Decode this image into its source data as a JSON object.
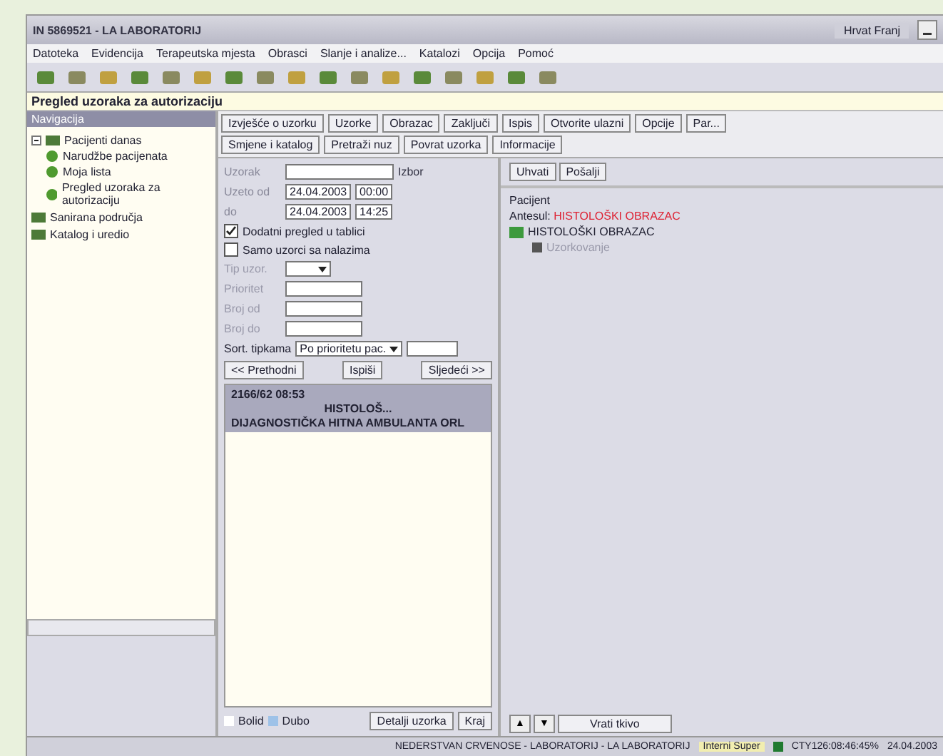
{
  "window": {
    "title": "IN 5869521 - LA LABORATORIJ",
    "user": "Hrvat Franj"
  },
  "menu": [
    "Datoteka",
    "Evidencija",
    "Terapeutska mjesta",
    "Obrasci",
    "Slanje i analize...",
    "Katalozi",
    "Opcija",
    "Pomoć"
  ],
  "header": "Pregled uzoraka za autorizaciju",
  "sidebar": {
    "title": "Navigacija",
    "items": [
      {
        "label": "Pacijenti danas",
        "expanded": true,
        "children": [
          {
            "label": "Narudžbe pacijenata"
          },
          {
            "label": "Moja lista"
          },
          {
            "label": "Pregled uzoraka za autorizaciju"
          }
        ]
      },
      {
        "label": "Sanirana područja"
      },
      {
        "label": "Katalog i uredio"
      }
    ]
  },
  "actions_row1": [
    "Izvješće o uzorku",
    "Uzorke",
    "Obrazac",
    "Zaključi",
    "Ispis",
    "Otvorite ulazni",
    "Opcije",
    "Par..."
  ],
  "actions_row2": [
    "Smjene i katalog",
    "Pretraži nuz",
    "Povrat uzorka",
    "Informacije"
  ],
  "filter": {
    "sample_label": "Uzorak",
    "find": "Izbor",
    "from_label": "Uzeto od",
    "to_label": "do",
    "from_date": "24.04.2003",
    "from_time": "00:00",
    "to_date": "24.04.2003",
    "to_time": "14:25",
    "checks": [
      {
        "label": "Dodatni pregled u tablici",
        "checked": true
      },
      {
        "label": "Samo uzorci sa nalazima",
        "checked": false
      }
    ],
    "fields": [
      {
        "label": "Tip uzor.",
        "kind": "select"
      },
      {
        "label": "Prioritet",
        "kind": "text"
      },
      {
        "label": "Broj od",
        "kind": "text"
      },
      {
        "label": "Broj do",
        "kind": "text"
      }
    ],
    "sort_label": "Sort. tipkama",
    "sort_value": "Po prioritetu pac.",
    "buttons": [
      "<< Prethodni",
      "Ispiši",
      "Sljedeći >>"
    ]
  },
  "results": [
    {
      "id": "2166/62 08:53",
      "type": "HISTOLOŠ...",
      "dept": "DIJAGNOSTIČKA HITNA AMBULANTA ORL",
      "selected": true
    }
  ],
  "legend": [
    "Bolid",
    "Dubo"
  ],
  "bottom_buttons": [
    "Detalji uzorka",
    "Kraj"
  ],
  "detail": {
    "buttons": [
      "Uhvati",
      "Pošalji"
    ],
    "patient_label": "Pacijent",
    "form_label": "Antesul:",
    "form_value": "HISTOLOŠKI OBRAZAC",
    "tree_root": "HISTOLOŠKI OBRAZAC",
    "tree_child": "Uzorkovanje",
    "nav": [
      "▲",
      "▼"
    ],
    "return_button": "Vrati tkivo"
  },
  "status_bar": [
    "NEDERSTVAN CRVENOSE - LABORATORIJ - LA LABORATORIJ",
    "Interni Super",
    "CTY126:08:46:45%",
    "24.04.2003"
  ]
}
